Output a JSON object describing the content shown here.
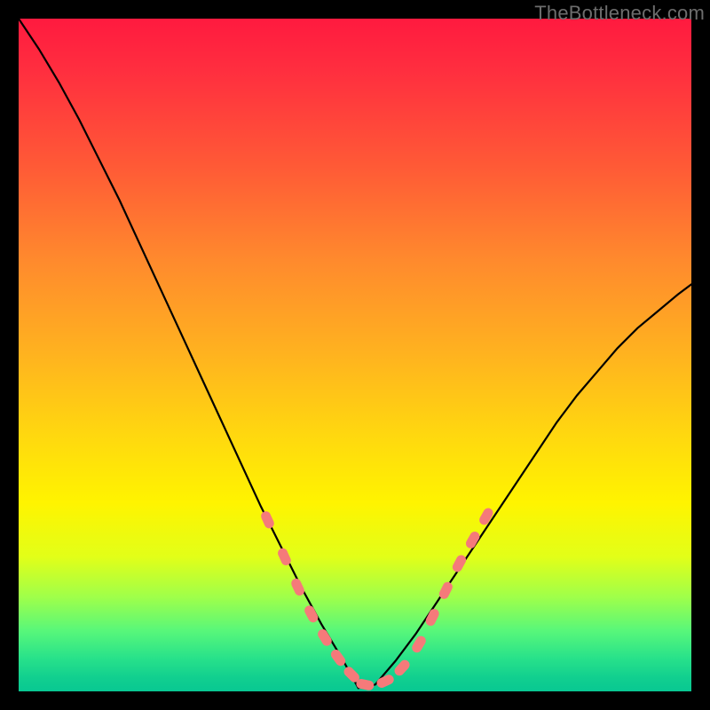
{
  "watermark": "TheBottleneck.com",
  "chart_data": {
    "type": "line",
    "title": "",
    "xlabel": "",
    "ylabel": "",
    "xlim": [
      0,
      1
    ],
    "ylim": [
      0,
      1
    ],
    "grid": false,
    "legend": false,
    "series": [
      {
        "name": "curve",
        "stroke": "#000000",
        "x": [
          0.0,
          0.03,
          0.06,
          0.09,
          0.12,
          0.15,
          0.18,
          0.21,
          0.24,
          0.27,
          0.3,
          0.33,
          0.36,
          0.39,
          0.42,
          0.45,
          0.48,
          0.505,
          0.53,
          0.56,
          0.59,
          0.62,
          0.65,
          0.68,
          0.71,
          0.74,
          0.77,
          0.8,
          0.83,
          0.86,
          0.89,
          0.92,
          0.95,
          0.98,
          1.0
        ],
        "y": [
          1.0,
          0.955,
          0.905,
          0.85,
          0.79,
          0.73,
          0.665,
          0.6,
          0.535,
          0.47,
          0.405,
          0.34,
          0.275,
          0.215,
          0.155,
          0.1,
          0.05,
          0.005,
          0.01,
          0.045,
          0.085,
          0.13,
          0.175,
          0.22,
          0.265,
          0.31,
          0.355,
          0.4,
          0.44,
          0.475,
          0.51,
          0.54,
          0.565,
          0.59,
          0.605
        ]
      }
    ],
    "markers": {
      "color": "#f57a7a",
      "x": [
        0.37,
        0.395,
        0.415,
        0.435,
        0.455,
        0.475,
        0.495,
        0.515,
        0.545,
        0.57,
        0.595,
        0.615,
        0.635,
        0.655,
        0.675,
        0.695
      ],
      "y": [
        0.255,
        0.2,
        0.155,
        0.115,
        0.08,
        0.05,
        0.025,
        0.01,
        0.015,
        0.035,
        0.07,
        0.11,
        0.15,
        0.19,
        0.225,
        0.26
      ]
    }
  }
}
